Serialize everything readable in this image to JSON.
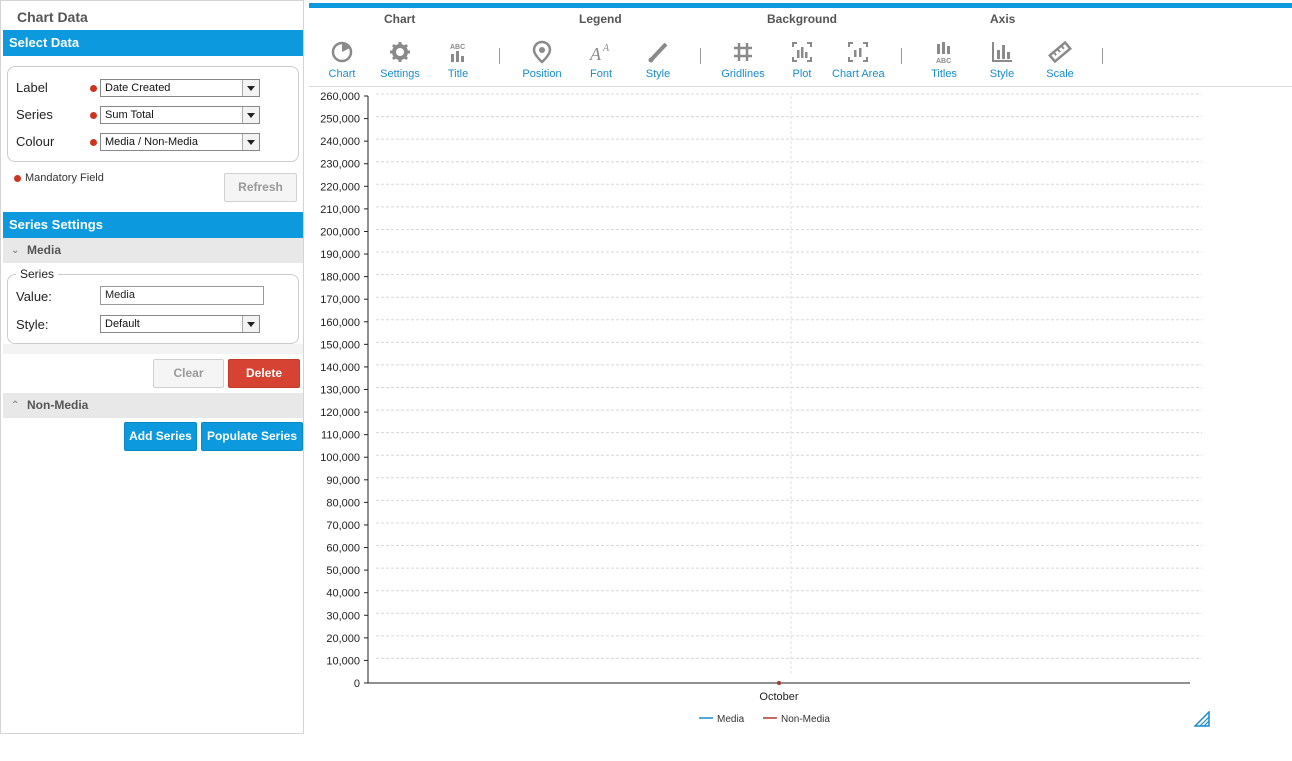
{
  "left": {
    "title": "Chart Data",
    "select_data": {
      "header": "Select Data",
      "fields": [
        {
          "label": "Label",
          "value": "Date Created"
        },
        {
          "label": "Series",
          "value": "Sum Total"
        },
        {
          "label": "Colour",
          "value": "Media / Non-Media"
        }
      ],
      "mandatory_note": "Mandatory Field",
      "refresh_label": "Refresh"
    },
    "series_settings": {
      "header": "Series Settings",
      "media_header": "Media",
      "group_legend": "Series",
      "value_label": "Value:",
      "value_input": "Media",
      "style_label": "Style:",
      "style_value": "Default",
      "clear_label": "Clear",
      "delete_label": "Delete",
      "nonmedia_header": "Non-Media",
      "add_series_label": "Add Series",
      "populate_series_label": "Populate Series"
    }
  },
  "tabs": [
    "Chart",
    "Legend",
    "Background",
    "Axis"
  ],
  "toolbar": [
    {
      "label": "Chart",
      "icon": "pie-chart-icon"
    },
    {
      "label": "Settings",
      "icon": "gear-icon"
    },
    {
      "label": "Title",
      "icon": "title-abc-icon"
    },
    {
      "label": "Position",
      "icon": "location-pin-icon"
    },
    {
      "label": "Font",
      "icon": "font-icon"
    },
    {
      "label": "Style",
      "icon": "brush-icon"
    },
    {
      "label": "Gridlines",
      "icon": "grid-icon"
    },
    {
      "label": "Plot",
      "icon": "plot-area-icon"
    },
    {
      "label": "Chart Area",
      "icon": "chart-area-icon"
    },
    {
      "label": "Titles",
      "icon": "axis-titles-icon"
    },
    {
      "label": "Style",
      "icon": "axis-style-icon"
    },
    {
      "label": "Scale",
      "icon": "ruler-icon"
    }
  ],
  "colors": {
    "accent": "#0d99dd",
    "delete": "#d64333",
    "required_dot": "#cc3322",
    "media_series": "#1a8ccc",
    "nonmedia_series": "#b03a2e"
  },
  "chart_data": {
    "type": "line",
    "categories": [
      "October"
    ],
    "series": [
      {
        "name": "Media",
        "values": [
          0
        ]
      },
      {
        "name": "Non-Media",
        "values": [
          0
        ]
      }
    ],
    "ylim": [
      0,
      260000
    ],
    "y_tick_step": 10000,
    "y_tick_labels": [
      "0",
      "10,000",
      "20,000",
      "30,000",
      "40,000",
      "50,000",
      "60,000",
      "70,000",
      "80,000",
      "90,000",
      "100,000",
      "110,000",
      "120,000",
      "130,000",
      "140,000",
      "150,000",
      "160,000",
      "170,000",
      "180,000",
      "190,000",
      "200,000",
      "210,000",
      "220,000",
      "230,000",
      "240,000",
      "250,000",
      "260,000"
    ],
    "grid": true,
    "legend_position": "bottom-center"
  }
}
